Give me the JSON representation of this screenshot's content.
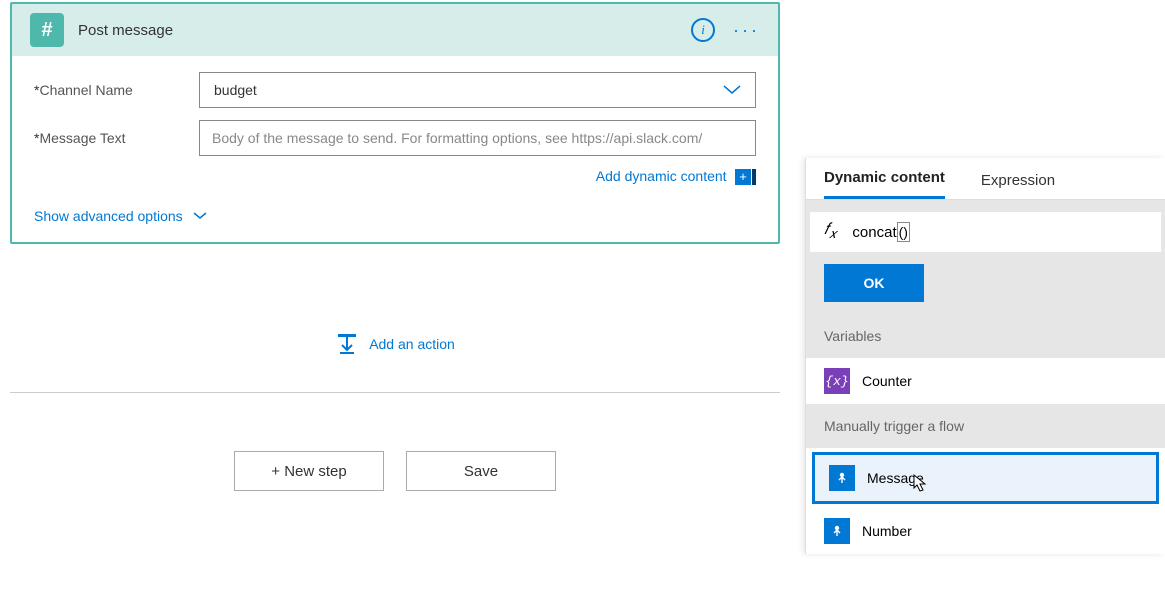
{
  "card": {
    "title": "Post message",
    "icon": "hash-icon",
    "fields": {
      "channel": {
        "label": "Channel Name",
        "value": "budget"
      },
      "message": {
        "label": "Message Text",
        "placeholder": "Body of the message to send. For formatting options, see https://api.slack.com/"
      }
    },
    "addDynamic": "Add dynamic content",
    "advancedOptions": "Show advanced options"
  },
  "addAction": "Add an action",
  "buttons": {
    "newStep": "+ New step",
    "save": "Save"
  },
  "flyout": {
    "tabs": {
      "dynamic": "Dynamic content",
      "expression": "Expression"
    },
    "fx": {
      "label": "fx",
      "value": "concat",
      "paren": "()"
    },
    "ok": "OK",
    "sections": {
      "variables": {
        "label": "Variables",
        "items": [
          "Counter"
        ]
      },
      "trigger": {
        "label": "Manually trigger a flow",
        "items": [
          "Message",
          "Number"
        ]
      }
    }
  }
}
